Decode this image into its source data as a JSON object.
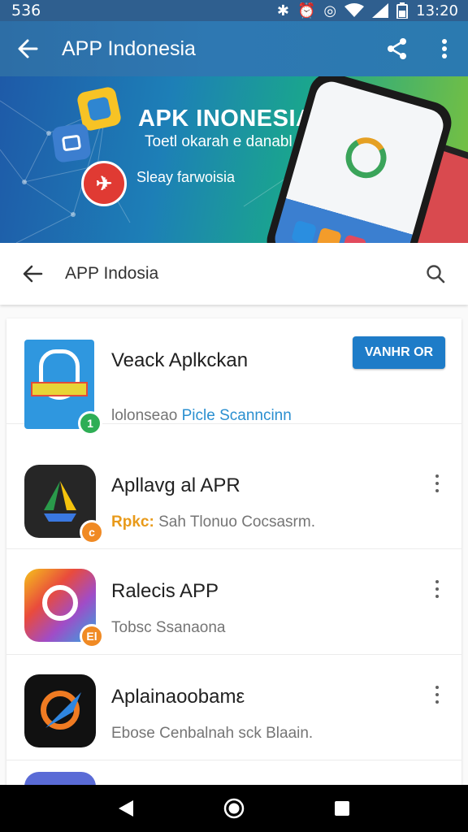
{
  "status_bar": {
    "left_text": "536",
    "time": "13:20"
  },
  "app_bar": {
    "title": "APP Indonesia"
  },
  "banner": {
    "title": "APK INONESIA",
    "subtitle": "Toetl okarah e danabl",
    "tagline": "Sleay farwoisia"
  },
  "search": {
    "query": "APP Indosia"
  },
  "apps": [
    {
      "name": "Veack Aplkckan",
      "desc_prefix": "lolonseao",
      "desc_link": "Picle Scanncinn",
      "install_label": "VANHR OR",
      "badge": "1"
    },
    {
      "name": "Apllavg al APR",
      "desc_prefix": "Rpkc:",
      "desc_rest": "Sah Tlonuo Cocsasrm.",
      "badge": "c"
    },
    {
      "name": "Ralecis APP",
      "desc": "Tobsc Ssanaona",
      "badge": "El"
    },
    {
      "name": "Aplainaoobamε",
      "desc": "Ebose Cenbalnah sck Blaain."
    }
  ],
  "colors": {
    "accent": "#1e7cc8",
    "app_bar": "#2e78b2",
    "install": "#1e7cc8"
  }
}
